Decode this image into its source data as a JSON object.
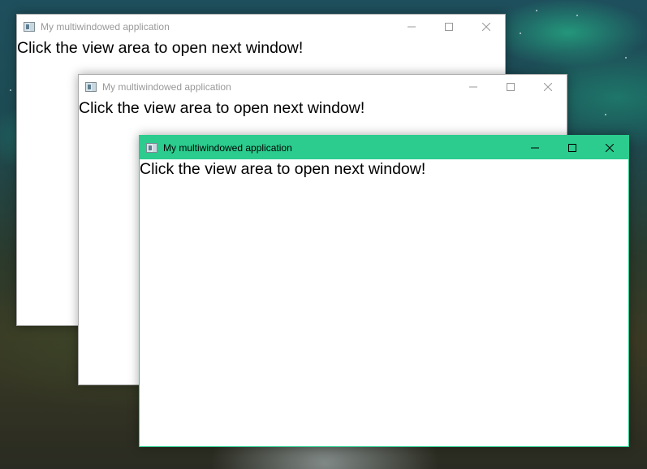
{
  "windows": [
    {
      "title": "My multiwindowed application",
      "content_text": "Click the view area to open next window!",
      "state": "inactive"
    },
    {
      "title": "My multiwindowed application",
      "content_text": "Click the view area to open next window!",
      "state": "inactive"
    },
    {
      "title": "My multiwindowed application",
      "content_text": "Click the view area to open next window!",
      "state": "active"
    }
  ],
  "colors": {
    "active_titlebar": "#2bcc8e",
    "inactive_titlebar": "#ffffff",
    "inactive_title_text": "#999999"
  },
  "icons": {
    "app": "app-window-icon",
    "minimize": "minimize-icon",
    "maximize": "maximize-icon",
    "close": "close-icon"
  }
}
